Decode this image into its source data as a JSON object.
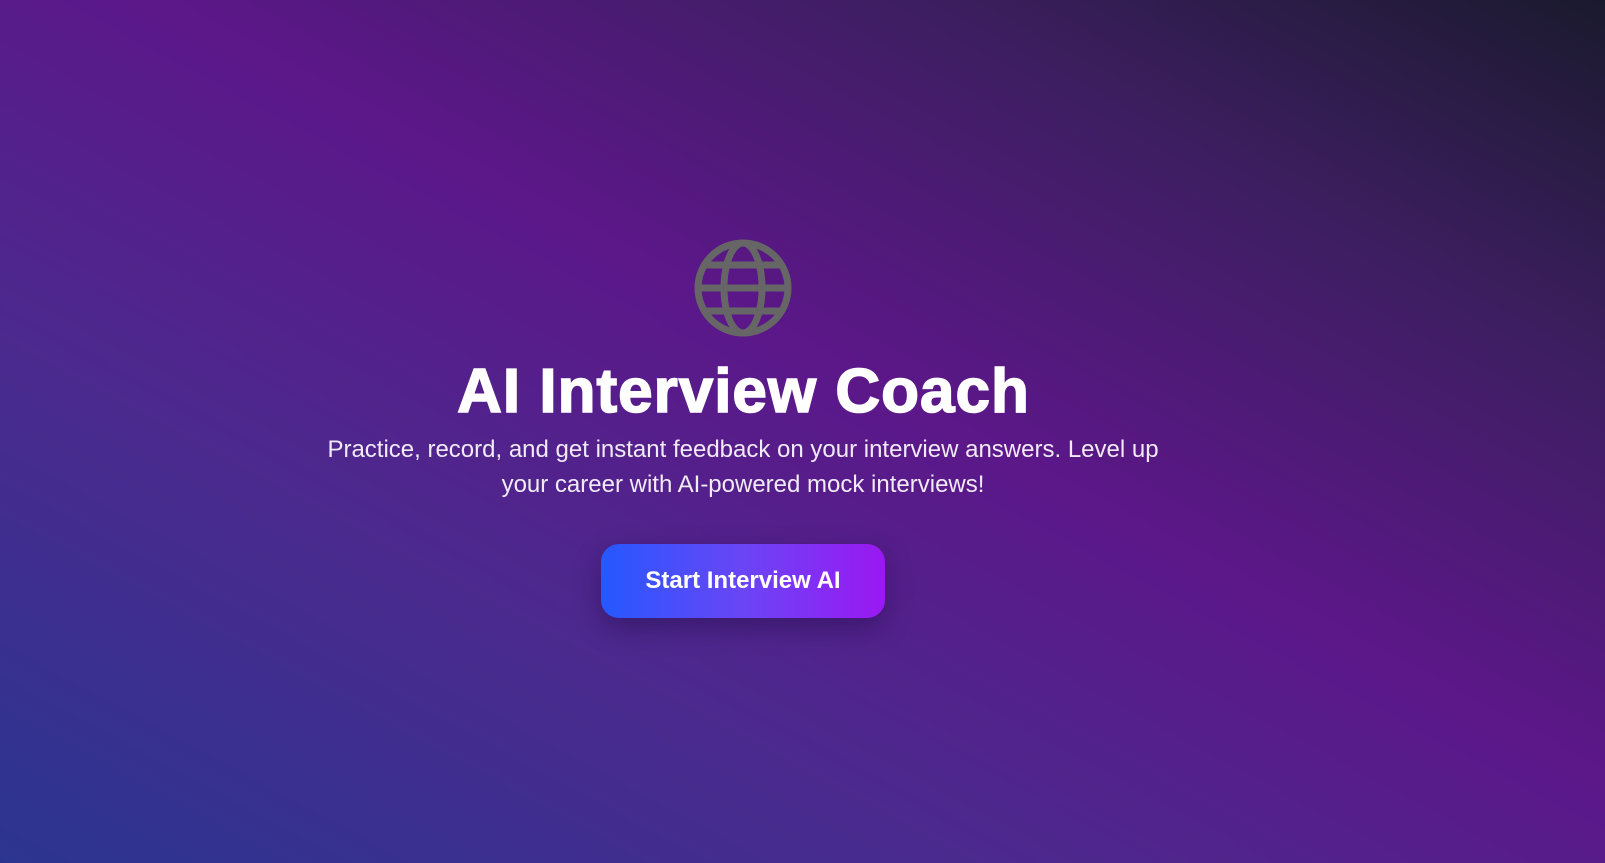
{
  "hero": {
    "icon": "globe-icon",
    "title": "AI Interview Coach",
    "subtitle": "Practice, record, and get instant feedback on your interview answers. Level up your career with AI-powered mock interviews!",
    "start_button_label": "Start Interview AI"
  },
  "colors": {
    "background_start": "#2b3590",
    "background_mid": "#5c1789",
    "background_end": "#1a1a2e",
    "button_start": "#2558ff",
    "button_end": "#9a18f2",
    "icon": "#666666"
  }
}
